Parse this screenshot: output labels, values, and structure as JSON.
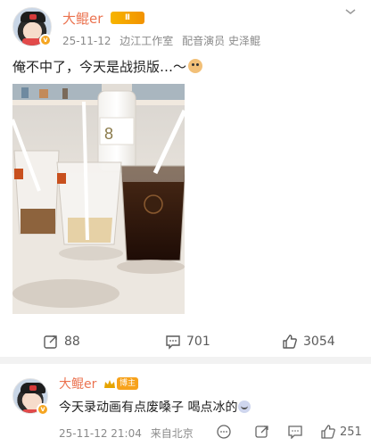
{
  "post": {
    "author": "大鲲er",
    "level_badge": "Ⅱ",
    "time": "25-11-12",
    "source": "边江工作室",
    "role": "配音演员 史泽鲲",
    "text": "俺不中了，今天是战损版…～",
    "actions": {
      "repost": "88",
      "comment": "701",
      "like": "3054"
    }
  },
  "comment": {
    "author": "大鲲er",
    "badge": "博主",
    "text": "今天录动画有点废嗓子  喝点冰的",
    "time": "25-11-12 21:04",
    "location": "来自北京",
    "like": "251"
  },
  "colors": {
    "name": "#eb7350",
    "verify": "#f5a623",
    "meta": "#8a8a8a"
  }
}
